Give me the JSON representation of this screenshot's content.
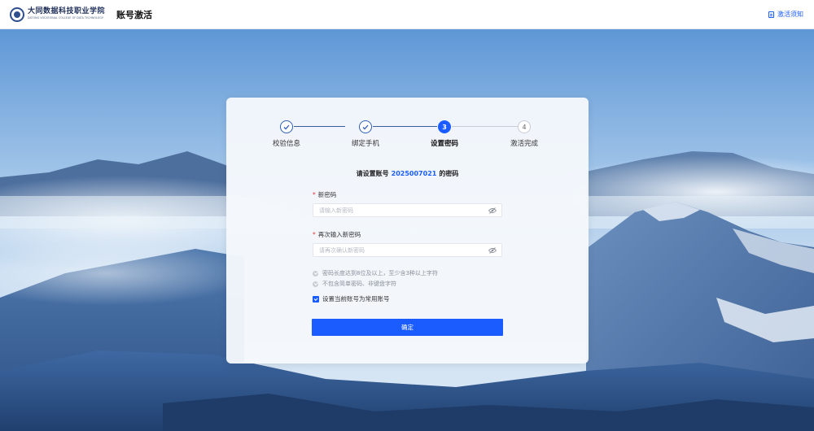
{
  "header": {
    "logo_cn": "大同数据科技职业学院",
    "logo_en": "DATONG VOCATIONAL COLLEGE OF DATA TECHNOLOGY",
    "page_title": "账号激活",
    "notice_label": "激活须知"
  },
  "steps": [
    {
      "label": "校验信息",
      "status": "done",
      "number": "1"
    },
    {
      "label": "绑定手机",
      "status": "done",
      "number": "2"
    },
    {
      "label": "设置密码",
      "status": "active",
      "number": "3"
    },
    {
      "label": "激活完成",
      "status": "todo",
      "number": "4"
    }
  ],
  "prompt": {
    "prefix": "请设置账号",
    "account": "2025007021",
    "suffix": "的密码"
  },
  "form": {
    "new_password": {
      "label": "新密码",
      "placeholder": "请输入新密码",
      "value": ""
    },
    "confirm_password": {
      "label": "再次输入新密码",
      "placeholder": "请再次确认新密码",
      "value": ""
    },
    "rules": [
      "密码长度达到8位及以上，至少含3种以上字符",
      "不包含简单密码、非键盘字符"
    ],
    "remember_label": "设置当前账号为常用账号",
    "remember_checked": true,
    "submit_label": "确定"
  },
  "colors": {
    "accent": "#1a5cff",
    "required": "#e23b3b",
    "done_step": "#2f5fb8"
  },
  "icons": {
    "logo": "college-seal-icon",
    "notice": "document-icon",
    "password_toggle": "eye-slash-icon",
    "step_done": "check-icon"
  }
}
